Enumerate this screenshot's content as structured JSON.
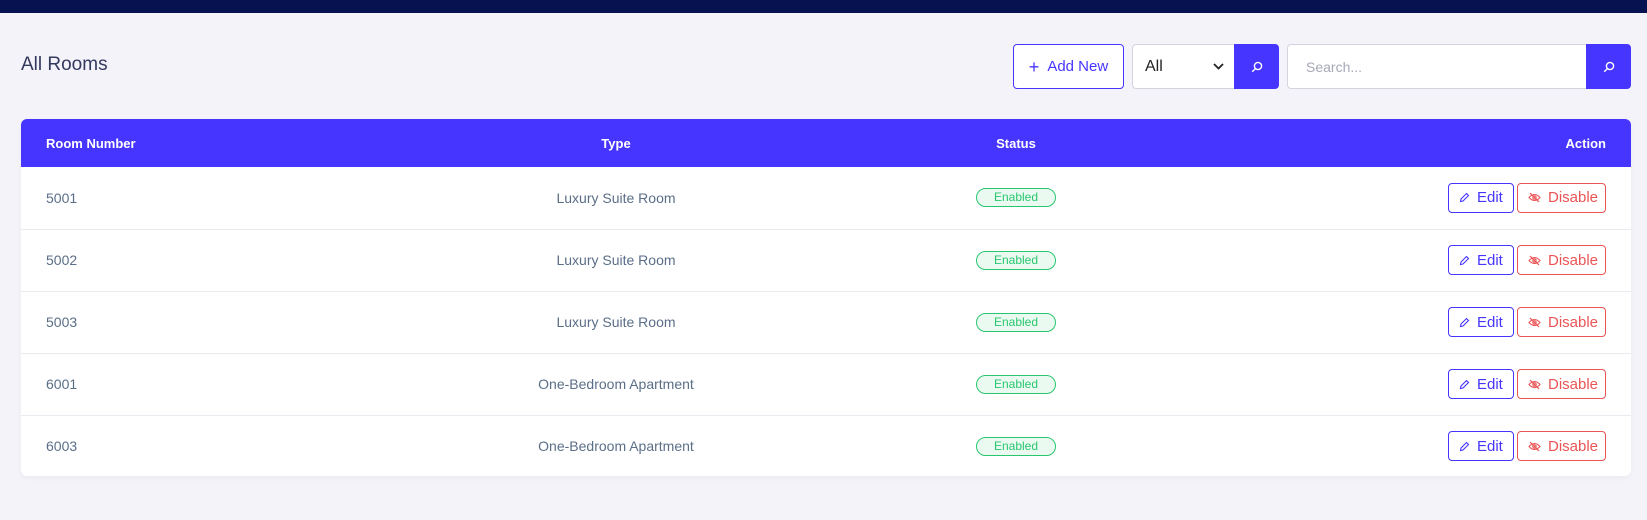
{
  "page": {
    "title": "All Rooms"
  },
  "toolbar": {
    "add_label": "Add New",
    "filter_value": "All",
    "search_placeholder": "Search..."
  },
  "colors": {
    "primary": "#4634ff",
    "topbar": "#071251",
    "success": "#28c76f",
    "danger": "#ea5455"
  },
  "table": {
    "headers": {
      "room_number": "Room Number",
      "type": "Type",
      "status": "Status",
      "action": "Action"
    },
    "rows": [
      {
        "room_number": "5001",
        "type": "Luxury Suite Room",
        "status": "Enabled",
        "edit": "Edit",
        "disable": "Disable"
      },
      {
        "room_number": "5002",
        "type": "Luxury Suite Room",
        "status": "Enabled",
        "edit": "Edit",
        "disable": "Disable"
      },
      {
        "room_number": "5003",
        "type": "Luxury Suite Room",
        "status": "Enabled",
        "edit": "Edit",
        "disable": "Disable"
      },
      {
        "room_number": "6001",
        "type": "One-Bedroom Apartment",
        "status": "Enabled",
        "edit": "Edit",
        "disable": "Disable"
      },
      {
        "room_number": "6003",
        "type": "One-Bedroom Apartment",
        "status": "Enabled",
        "edit": "Edit",
        "disable": "Disable"
      }
    ]
  }
}
